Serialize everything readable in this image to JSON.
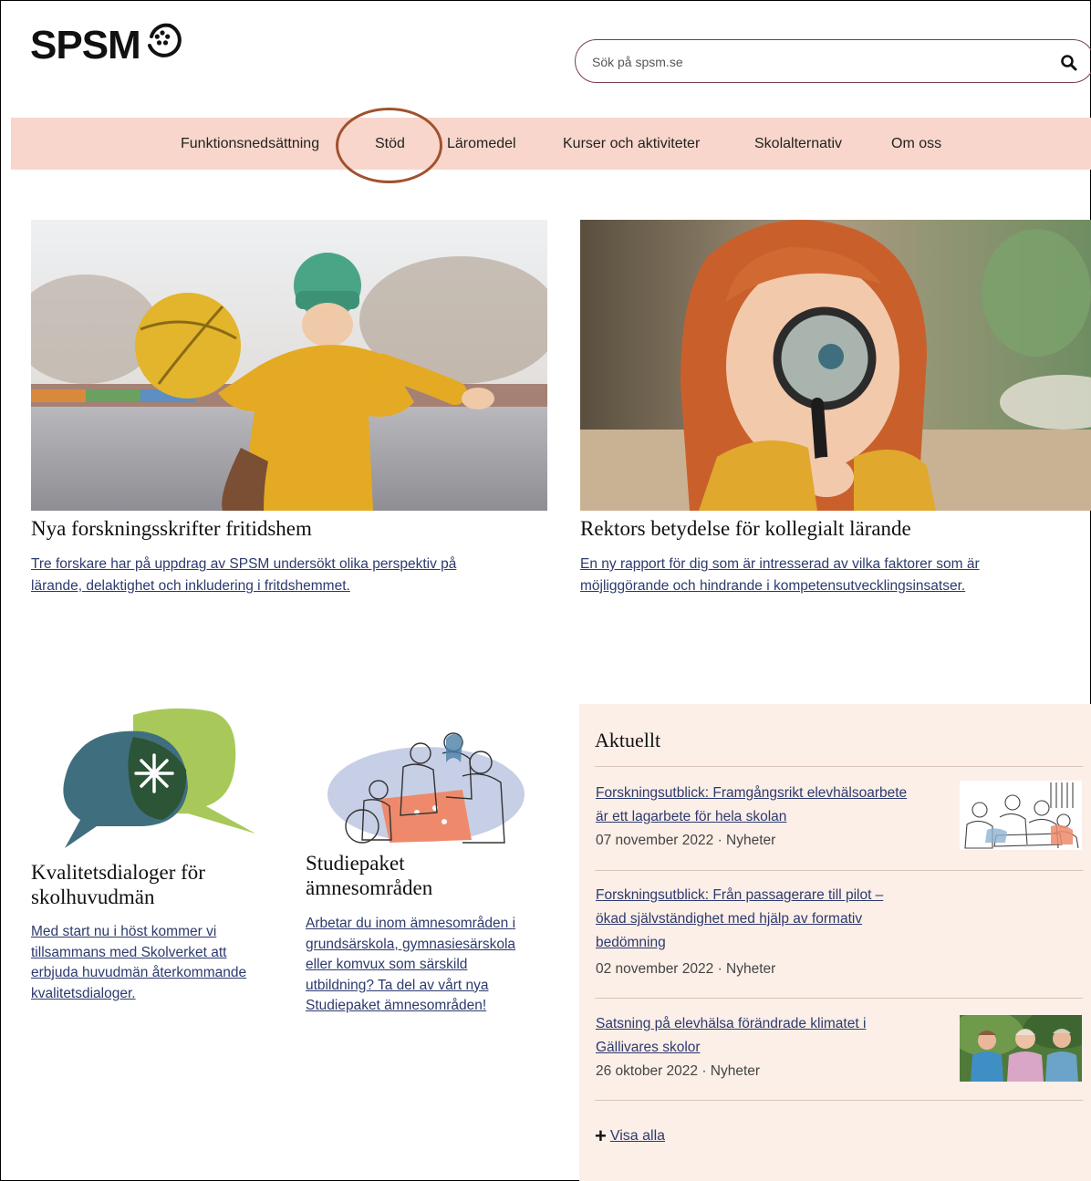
{
  "header": {
    "logo_text": "SPSM",
    "search": {
      "placeholder": "Sök på spsm.se",
      "value": ""
    }
  },
  "nav": {
    "items": [
      {
        "label": "Funktionsnedsättning"
      },
      {
        "label": "Stöd"
      },
      {
        "label": "Läromedel"
      },
      {
        "label": "Kurser och aktiviteter"
      },
      {
        "label": "Skolalternativ"
      },
      {
        "label": "Om oss"
      }
    ]
  },
  "features": [
    {
      "title": "Nya forskningsskrifter fritidshem",
      "link_line1": "Tre forskare har på uppdrag av SPSM undersökt olika perspektiv på",
      "link_line2": "lärande, delaktighet och inkludering i fritdshemmet."
    },
    {
      "title": "Rektors betydelse för kollegialt lärande",
      "link_line1": "En ny rapport för dig som är intresserad av vilka faktorer som är",
      "link_line2": "möjliggörande och hindrande i kompetensutvecklingsinsatser."
    }
  ],
  "cards": [
    {
      "title_line1": "Kvalitetsdialoger för",
      "title_line2": "skolhuvudmän",
      "link_lines": [
        "Med start nu i höst kommer vi",
        "tillsammans med Skolverket att",
        "erbjuda huvudmän återkommande",
        "kvalitetsdialoger."
      ]
    },
    {
      "title_line1": "Studiepaket",
      "title_line2": "ämnesområden",
      "link_lines": [
        "Arbetar du inom ämnesområden i",
        "grundsärskola, gymnasiesärskola",
        "eller komvux som särskild",
        "utbildning? Ta del av vårt nya",
        "Studiepaket ämnesområden!"
      ]
    }
  ],
  "news": {
    "heading": "Aktuellt",
    "items": [
      {
        "lines": [
          "Forskningsutblick: Framgångsrikt elevhälsoarbete",
          "är ett lagarbete för hela skolan"
        ],
        "meta": "07 november 2022 · Nyheter"
      },
      {
        "lines": [
          "Forskningsutblick: Från passagerare till pilot –",
          "ökad självständighet med hjälp av formativ",
          "bedömning"
        ],
        "meta": "02 november 2022 · Nyheter"
      },
      {
        "lines": [
          "Satsning på elevhälsa förändrade klimatet i",
          "Gällivares skolor"
        ],
        "meta": "26 oktober 2022 · Nyheter"
      }
    ],
    "show_all": "Visa alla"
  }
}
